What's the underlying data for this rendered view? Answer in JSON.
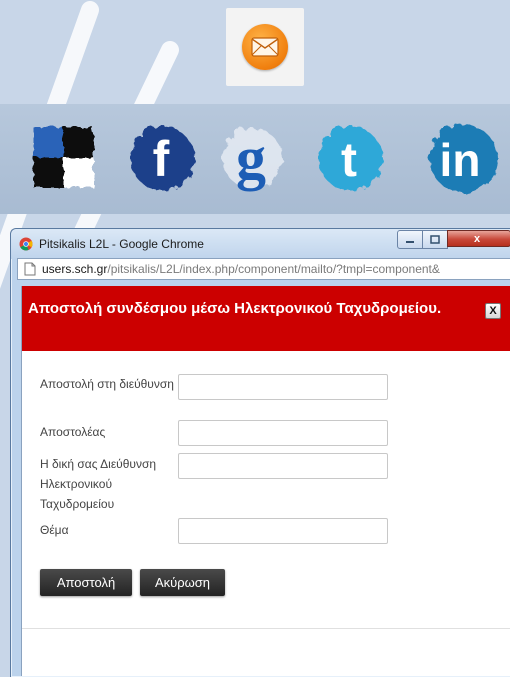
{
  "background": {
    "mail_icon": "mail-envelope-icon",
    "social_icons": [
      "delicious-icon",
      "facebook-icon",
      "google-icon",
      "twitter-icon",
      "linkedin-icon"
    ]
  },
  "window": {
    "title": "Pitsikalis L2L - Google Chrome",
    "controls": {
      "close": "x"
    }
  },
  "address": {
    "host": "users.sch.gr",
    "path": "/pitsikalis/L2L/index.php/component/mailto/?tmpl=component&"
  },
  "modal": {
    "title": "Αποστολή συνδέσμου μέσω Ηλεκτρονικού Ταχυδρομείου.",
    "close_label": "X",
    "fields": [
      {
        "label": "Αποστολή στη διεύθυνση",
        "value": "",
        "placeholder": ""
      },
      {
        "label": "Αποστολέας",
        "value": "",
        "placeholder": ""
      },
      {
        "label": "Η δική σας Διεύθυνση Ηλεκτρονικού Ταχυδρομείου",
        "value": "",
        "placeholder": ""
      },
      {
        "label": "Θέμα",
        "value": "",
        "placeholder": ""
      }
    ],
    "send_label": "Αποστολή",
    "cancel_label": "Ακύρωση"
  },
  "colors": {
    "header_red": "#cc0000",
    "button_dark": "#2b2b2b",
    "mail_orange": "#f07f0e"
  }
}
